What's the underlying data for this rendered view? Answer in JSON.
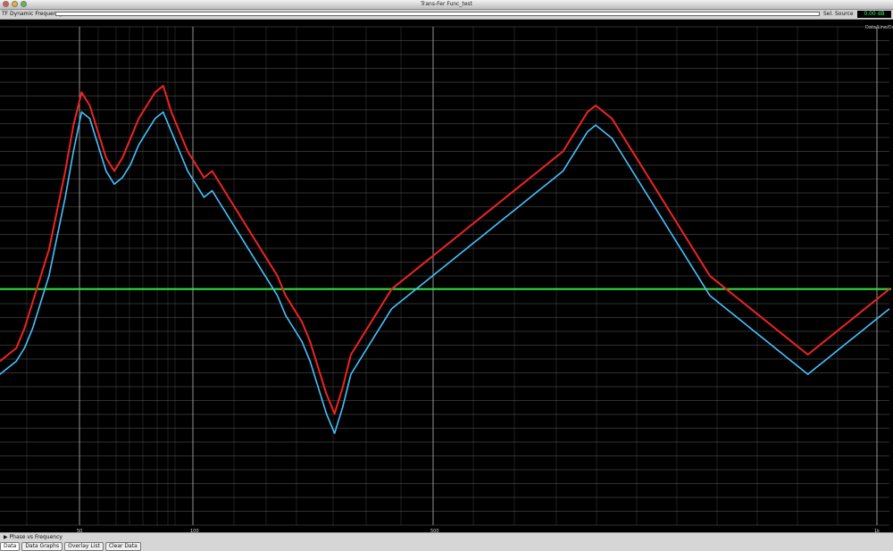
{
  "window": {
    "title": "Trans-Fer Func_test"
  },
  "toolbar": {
    "mode_label": "TF Dynamic Frequency",
    "right_label": "Sel. Source",
    "value": "0.00 dB"
  },
  "plot": {
    "top_right_label": "Data/Line/Dot",
    "reference_color": "#31e038",
    "series_colors": {
      "red": "#ef2323",
      "blue": "#45c3ff"
    }
  },
  "bottom": {
    "disclosure": "Phase vs Frequency",
    "tabs": [
      "Data",
      "Data Graphs",
      "Overlay List",
      "Clear Data"
    ]
  },
  "chart_data": {
    "type": "line",
    "xlabels": [
      "50",
      "100",
      "500",
      "1k"
    ],
    "series": [
      {
        "values": [
          -11,
          -10,
          -9,
          -6,
          -2,
          2,
          6,
          12,
          18,
          25,
          30,
          28,
          24,
          20,
          18,
          20,
          23,
          26,
          28,
          30,
          31,
          27,
          24,
          21,
          19,
          17,
          18,
          16,
          14,
          12,
          10,
          8,
          6,
          4,
          2,
          -1,
          -3,
          -5,
          -8,
          -12,
          -16,
          -19,
          -15,
          -10,
          -8,
          -6,
          -4,
          -2,
          0,
          1,
          2,
          3,
          4,
          5,
          6,
          7,
          8,
          9,
          10,
          11,
          12,
          13,
          14,
          15,
          16,
          17,
          18,
          19,
          20,
          21,
          23,
          25,
          27,
          28,
          27,
          26,
          24,
          22,
          20,
          18,
          16,
          14,
          12,
          10,
          8,
          6,
          4,
          2,
          1,
          0,
          -1,
          -2,
          -3,
          -4,
          -5,
          -6,
          -7,
          -8,
          -9,
          -10,
          -9,
          -8,
          -7,
          -6,
          -5,
          -4,
          -3,
          -2,
          -1,
          0
        ]
      },
      {
        "values": [
          -13,
          -12,
          -11,
          -9,
          -6,
          -2,
          2,
          8,
          14,
          21,
          27,
          26,
          22,
          18,
          16,
          17,
          19,
          22,
          24,
          26,
          27,
          24,
          21,
          18,
          16,
          14,
          15,
          13,
          11,
          9,
          7,
          5,
          3,
          1,
          -1,
          -4,
          -6,
          -8,
          -11,
          -15,
          -19,
          -22,
          -18,
          -13,
          -11,
          -9,
          -7,
          -5,
          -3,
          -2,
          -1,
          0,
          1,
          2,
          3,
          4,
          5,
          6,
          7,
          8,
          9,
          10,
          11,
          12,
          13,
          14,
          15,
          16,
          17,
          18,
          20,
          22,
          24,
          25,
          24,
          23,
          21,
          19,
          17,
          15,
          13,
          11,
          9,
          7,
          5,
          3,
          1,
          -1,
          -2,
          -3,
          -4,
          -5,
          -6,
          -7,
          -8,
          -9,
          -10,
          -11,
          -12,
          -13,
          -12,
          -11,
          -10,
          -9,
          -8,
          -7,
          -6,
          -5,
          -4,
          -3
        ]
      }
    ],
    "ylim": [
      -36,
      40
    ],
    "reference_level": 0,
    "grid": true
  }
}
